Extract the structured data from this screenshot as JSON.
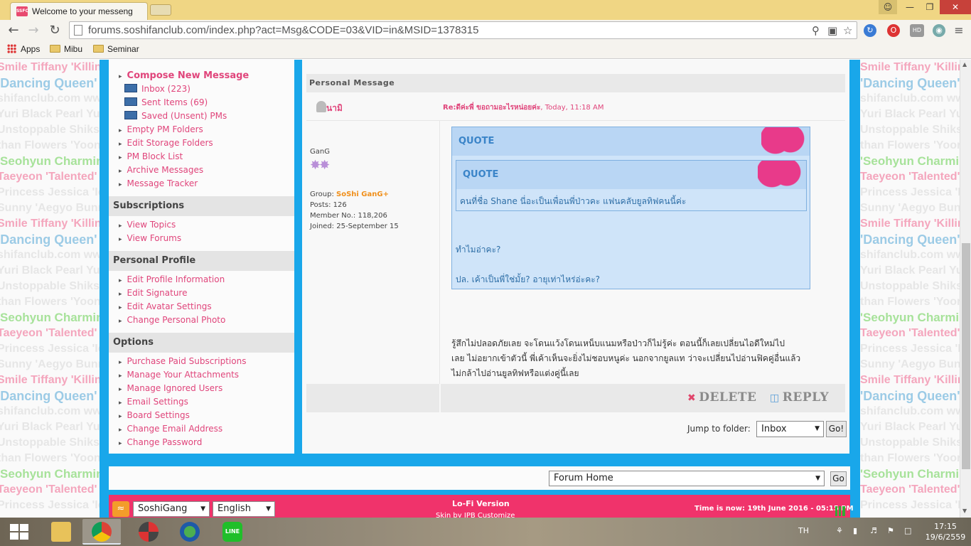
{
  "browser": {
    "tab_title": "Welcome to your messeng",
    "favicon_text": "SSFC",
    "url": "forums.soshifanclub.com/index.php?act=Msg&CODE=03&VID=in&MSID=1378315",
    "bookmarks": [
      "Apps",
      "Mibu",
      "Seminar"
    ]
  },
  "sidebar": {
    "compose": "Compose New Message",
    "folders": [
      "Inbox (223)",
      "Sent Items (69)",
      "Saved (Unsent) PMs"
    ],
    "pm_links": [
      "Empty PM Folders",
      "Edit Storage Folders",
      "PM Block List",
      "Archive Messages",
      "Message Tracker"
    ],
    "subscriptions_title": "Subscriptions",
    "subscriptions": [
      "View Topics",
      "View Forums"
    ],
    "profile_title": "Personal Profile",
    "profile": [
      "Edit Profile Information",
      "Edit Signature",
      "Edit Avatar Settings",
      "Change Personal Photo"
    ],
    "options_title": "Options",
    "options": [
      "Purchase Paid Subscriptions",
      "Manage Your Attachments",
      "Manage Ignored Users",
      "Email Settings",
      "Board Settings",
      "Change Email Address",
      "Change Password"
    ]
  },
  "message": {
    "section_title": "Personal Message",
    "sender": "นามิ",
    "title_bold": "Re:ดีค่ะพี่ ขอถามอะไรหน่อยค่ะ",
    "title_time": ", Today, 11:18 AM",
    "user_title": "GanG",
    "group_label": "Group: ",
    "group_value": "SoShi GanG+",
    "posts": "Posts: 126",
    "member_no": "Member No.: 118,206",
    "joined": "Joined: 25-September 15",
    "quote_label": "QUOTE",
    "inner_quote_label": "QUOTE",
    "inner_quote_text": "คนที่ชื่อ Shane นี่อะเป็นเพื่อนพี่ป่าวคะ แฟนคลับยูลทิฟคนนี้ค่ะ",
    "outer_quote_line1": "ทำไมอ่าคะ?",
    "outer_quote_line2": "ปล. เค้าเป็นพี่ใช่มั้ย? อายุเท่าไหร่อ่ะคะ?",
    "body_lines": [
      "รู้สึกไม่ปลอดภัยเลย จะโดนแว้งโดนเหน็บแนมหรือป่าวก็ไม่รู้ค่ะ ตอนนี้ก็เลยเปลี่ยนไอดีใหม่ไป",
      "เลย ไม่อยากเข้าตัวนี้ พี่เค้าเห็นจะยิ่งไม่ชอบหนูค่ะ นอกจากยูลแท ว่าจะเปลี่ยนไปอ่านฟิคคู่อื่นแล้ว",
      "ไม่กล้าไปอ่านยูลทิฟหรือแต่งคู่นี้เลย"
    ],
    "delete_label": "DELETE",
    "reply_label": "REPLY"
  },
  "jump": {
    "label": "Jump to folder:",
    "selected": "Inbox",
    "go": "Go!"
  },
  "forum_jump": {
    "selected": "Forum Home",
    "go": "Go"
  },
  "footer": {
    "skin_select": "SoshiGang",
    "lang_select": "English",
    "lofi": "Lo-Fi Version",
    "skin_credit": "Skin by IPB Customize",
    "time_now": "Time is now: 19th June 2016 - 05:15 PM"
  },
  "wallpaper_lines": [
    "Smile Tiffany 'Killing Sm",
    "'Dancing Queen' Hyo",
    "shifanclub.com www",
    "Yuri Black Pearl Yuri 'Bla",
    "Unstoppable Shikshin 'Yu",
    "than Flowers 'YoonA",
    "'Seohyun Charming' Seo",
    "Taeyeon 'Talented' Ta",
    "Princess Jessica 'Ice Pr",
    "Sunny 'Aegyo Bunny' Su"
  ],
  "taskbar": {
    "lang": "TH",
    "time": "17:15",
    "date": "19/6/2559"
  },
  "colors": {
    "accent_blue": "#19a7ea",
    "link_pink": "#e0457b",
    "footer_pink": "#f0336b"
  }
}
